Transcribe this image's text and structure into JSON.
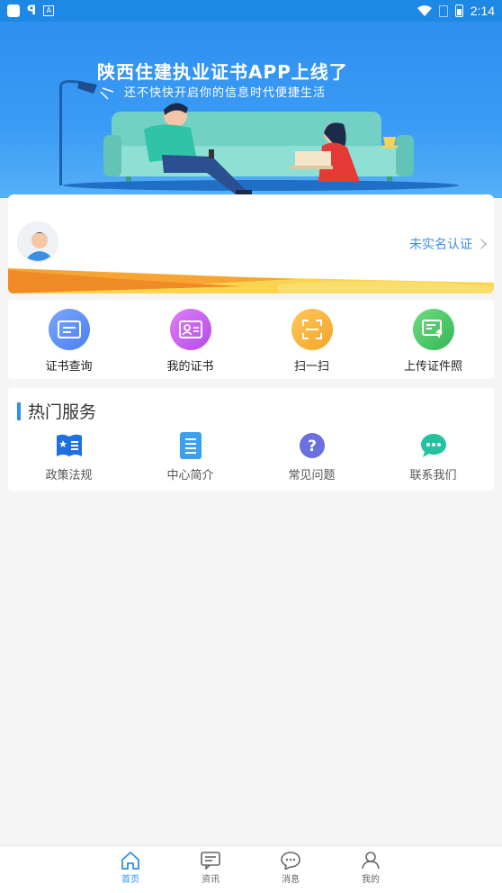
{
  "status_bar": {
    "time": "2:14"
  },
  "banner": {
    "title": "陕西住建执业证书APP上线了",
    "subtitle": "还不快快开启你的信息时代便捷生活"
  },
  "user_card": {
    "verify_label": "未实名认证"
  },
  "quick_actions": [
    {
      "label": "证书查询",
      "icon": "certificate-search-icon",
      "color": "#5b8ff5"
    },
    {
      "label": "我的证书",
      "icon": "my-certificate-icon",
      "color": "#c45ef0"
    },
    {
      "label": "扫一扫",
      "icon": "scan-icon",
      "color": "#f7b53c"
    },
    {
      "label": "上传证件照",
      "icon": "upload-photo-icon",
      "color": "#3ec46a"
    }
  ],
  "hot_services": {
    "title": "热门服务",
    "items": [
      {
        "label": "政策法规",
        "icon": "policy-book-icon"
      },
      {
        "label": "中心简介",
        "icon": "document-icon"
      },
      {
        "label": "常见问题",
        "icon": "question-icon"
      },
      {
        "label": "联系我们",
        "icon": "chat-icon"
      }
    ]
  },
  "bottom_nav": [
    {
      "label": "首页",
      "icon": "home-icon",
      "active": true
    },
    {
      "label": "资讯",
      "icon": "news-icon",
      "active": false
    },
    {
      "label": "消息",
      "icon": "message-icon",
      "active": false
    },
    {
      "label": "我的",
      "icon": "profile-icon",
      "active": false
    }
  ],
  "colors": {
    "accent": "#2f8ff0",
    "banner": "#2f8ff0",
    "verify_text": "#3d8ee8"
  }
}
